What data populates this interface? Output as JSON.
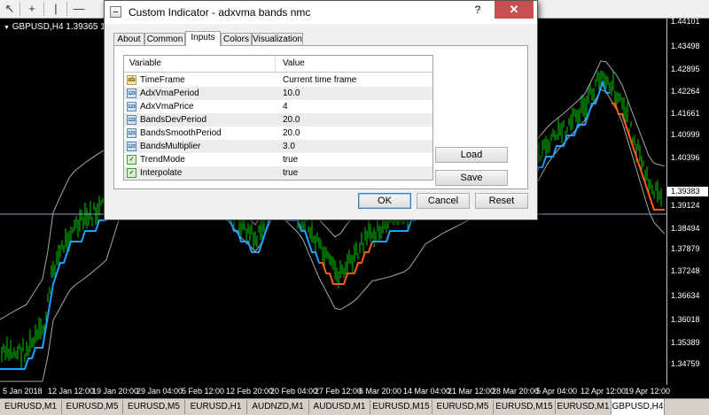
{
  "chart": {
    "symbol_label": "GBPUSD,H4  1.39365 1.39386",
    "current_price": "1.39383",
    "price_ticks": [
      "1.44101",
      "1.43498",
      "1.42895",
      "1.42264",
      "1.41661",
      "1.40999",
      "1.40396",
      "1.39383",
      "1.39124",
      "1.38494",
      "1.37879",
      "1.37248",
      "1.36634",
      "1.36018",
      "1.35389",
      "1.34759"
    ],
    "time_ticks": [
      "5 Jan 2018",
      "12 Jan 12:00",
      "19 Jan 20:00",
      "29 Jan 04:00",
      "5 Feb 12:00",
      "12 Feb 20:00",
      "20 Feb 04:00",
      "27 Feb 12:00",
      "6 Mar 20:00",
      "14 Mar 04:00",
      "21 Mar 12:00",
      "28 Mar 20:00",
      "5 Apr 04:00",
      "12 Apr 12:00",
      "19 Apr 12:00"
    ],
    "colors": {
      "bars": "#00cc00",
      "band": "#a8a8a8",
      "up_line": "#1ea0ff",
      "down_line": "#ff5a14",
      "bid_line": "#8aa0c8"
    }
  },
  "toolbar": {
    "icons": [
      "cursor-icon",
      "crosshair-icon",
      "vertical-line-icon",
      "horizontal-line-icon"
    ]
  },
  "symbol_tabs": [
    "EURUSD,M1",
    "EURUSD,M5",
    "EURUSD,M5",
    "EURUSD,H1",
    "AUDNZD,M1",
    "AUDUSD,M1",
    "EURUSD,M15",
    "EURUSD,M5",
    "EURUSD,M15",
    "EURUSD,M1",
    "GBPUSD,H4"
  ],
  "active_tab_index": 10,
  "dialog": {
    "title": "Custom Indicator - adxvma bands nmc",
    "help_label": "?",
    "close_label": "✕",
    "tabs": [
      "About",
      "Common",
      "Inputs",
      "Colors",
      "Visualization"
    ],
    "active_tab": "Inputs",
    "grid_headers": {
      "variable": "Variable",
      "value": "Value"
    },
    "inputs": [
      {
        "icon": "ab",
        "name": "TimeFrame",
        "value": "Current time frame"
      },
      {
        "icon": "123",
        "name": "AdxVmaPeriod",
        "value": "10.0"
      },
      {
        "icon": "123",
        "name": "AdxVmaPrice",
        "value": "4"
      },
      {
        "icon": "123",
        "name": "BandsDevPeriod",
        "value": "20.0"
      },
      {
        "icon": "123",
        "name": "BandsSmoothPeriod",
        "value": "20.0"
      },
      {
        "icon": "123",
        "name": "BandsMultiplier",
        "value": "3.0"
      },
      {
        "icon": "bool",
        "name": "TrendMode",
        "value": "true"
      },
      {
        "icon": "bool",
        "name": "Interpolate",
        "value": "true"
      }
    ],
    "load_label": "Load",
    "save_label": "Save",
    "ok_label": "OK",
    "cancel_label": "Cancel",
    "reset_label": "Reset"
  }
}
